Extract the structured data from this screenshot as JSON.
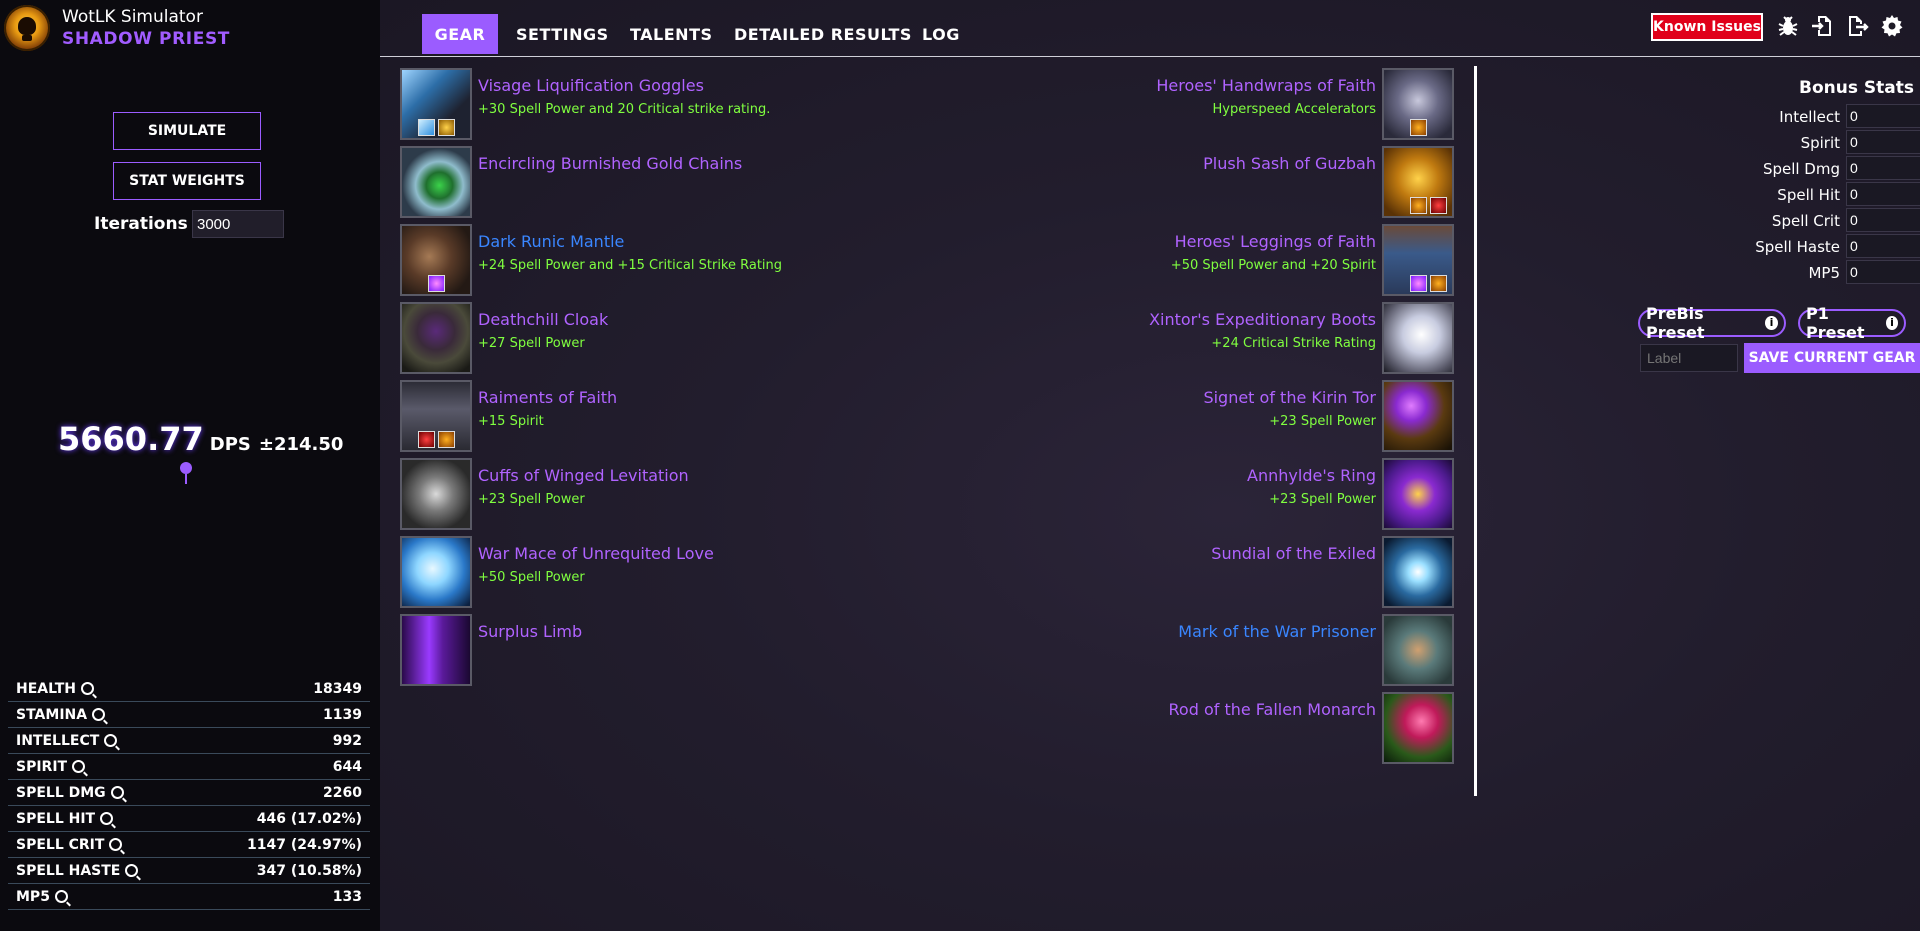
{
  "app": {
    "title": "WotLK Simulator",
    "class_name": "SHADOW PRIEST"
  },
  "sidebar": {
    "simulate_label": "SIMULATE",
    "stat_weights_label": "STAT WEIGHTS",
    "iterations_label": "Iterations",
    "iterations_value": "3000",
    "dps_value": "5660.77",
    "dps_unit": "DPS",
    "dps_error": "±214.50",
    "stats": [
      {
        "name": "HEALTH",
        "value": "18349"
      },
      {
        "name": "STAMINA",
        "value": "1139"
      },
      {
        "name": "INTELLECT",
        "value": "992"
      },
      {
        "name": "SPIRIT",
        "value": "644"
      },
      {
        "name": "SPELL DMG",
        "value": "2260"
      },
      {
        "name": "SPELL HIT",
        "value": "446 (17.02%)"
      },
      {
        "name": "SPELL CRIT",
        "value": "1147 (24.97%)"
      },
      {
        "name": "SPELL HASTE",
        "value": "347 (10.58%)"
      },
      {
        "name": "MP5",
        "value": "133"
      }
    ]
  },
  "nav": {
    "tabs": [
      "GEAR",
      "SETTINGS",
      "TALENTS",
      "DETAILED RESULTS",
      "LOG"
    ],
    "active_tab": "GEAR",
    "known_issues_label": "Known Issues",
    "icons": [
      "bug-icon",
      "import-icon",
      "export-icon",
      "gear-icon"
    ]
  },
  "gear": {
    "left": [
      {
        "name": "Visage Liquification Goggles",
        "enchant": "+30 Spell Power and 20 Critical strike rating.",
        "quality": "epic"
      },
      {
        "name": "Encircling Burnished Gold Chains",
        "enchant": "",
        "quality": "epic"
      },
      {
        "name": "Dark Runic Mantle",
        "enchant": "+24 Spell Power and +15 Critical Strike Rating",
        "quality": "rare"
      },
      {
        "name": "Deathchill Cloak",
        "enchant": "+27 Spell Power",
        "quality": "epic"
      },
      {
        "name": "Raiments of Faith",
        "enchant": "+15 Spirit",
        "quality": "epic"
      },
      {
        "name": "Cuffs of Winged Levitation",
        "enchant": "+23 Spell Power",
        "quality": "epic"
      },
      {
        "name": "War Mace of Unrequited Love",
        "enchant": "+50 Spell Power",
        "quality": "epic"
      },
      {
        "name": "Surplus Limb",
        "enchant": "",
        "quality": "epic"
      }
    ],
    "right": [
      {
        "name": "Heroes' Handwraps of Faith",
        "enchant": "Hyperspeed Accelerators",
        "quality": "epic"
      },
      {
        "name": "Plush Sash of Guzbah",
        "enchant": "",
        "quality": "epic"
      },
      {
        "name": "Heroes' Leggings of Faith",
        "enchant": "+50 Spell Power and +20 Spirit",
        "quality": "epic"
      },
      {
        "name": "Xintor's Expeditionary Boots",
        "enchant": "+24 Critical Strike Rating",
        "quality": "epic"
      },
      {
        "name": "Signet of the Kirin Tor",
        "enchant": "+23 Spell Power",
        "quality": "epic"
      },
      {
        "name": "Annhylde's Ring",
        "enchant": "+23 Spell Power",
        "quality": "epic"
      },
      {
        "name": "Sundial of the Exiled",
        "enchant": "",
        "quality": "epic"
      },
      {
        "name": "Mark of the War Prisoner",
        "enchant": "",
        "quality": "rare"
      },
      {
        "name": "Rod of the Fallen Monarch",
        "enchant": "",
        "quality": "epic"
      }
    ]
  },
  "bonus": {
    "title": "Bonus Stats",
    "rows": [
      {
        "label": "Intellect",
        "value": "0"
      },
      {
        "label": "Spirit",
        "value": "0"
      },
      {
        "label": "Spell Dmg",
        "value": "0"
      },
      {
        "label": "Spell Hit",
        "value": "0"
      },
      {
        "label": "Spell Crit",
        "value": "0"
      },
      {
        "label": "Spell Haste",
        "value": "0"
      },
      {
        "label": "MP5",
        "value": "0"
      }
    ],
    "prebis_label": "PreBis Preset",
    "p1_label": "P1 Preset",
    "label_placeholder": "Label",
    "save_label": "SAVE CURRENT GEAR"
  },
  "colors": {
    "accent": "#9b5cff",
    "epic": "#b063ff",
    "rare": "#3a86ff",
    "enchant": "#80ff40",
    "known_issues": "#e0001a"
  }
}
